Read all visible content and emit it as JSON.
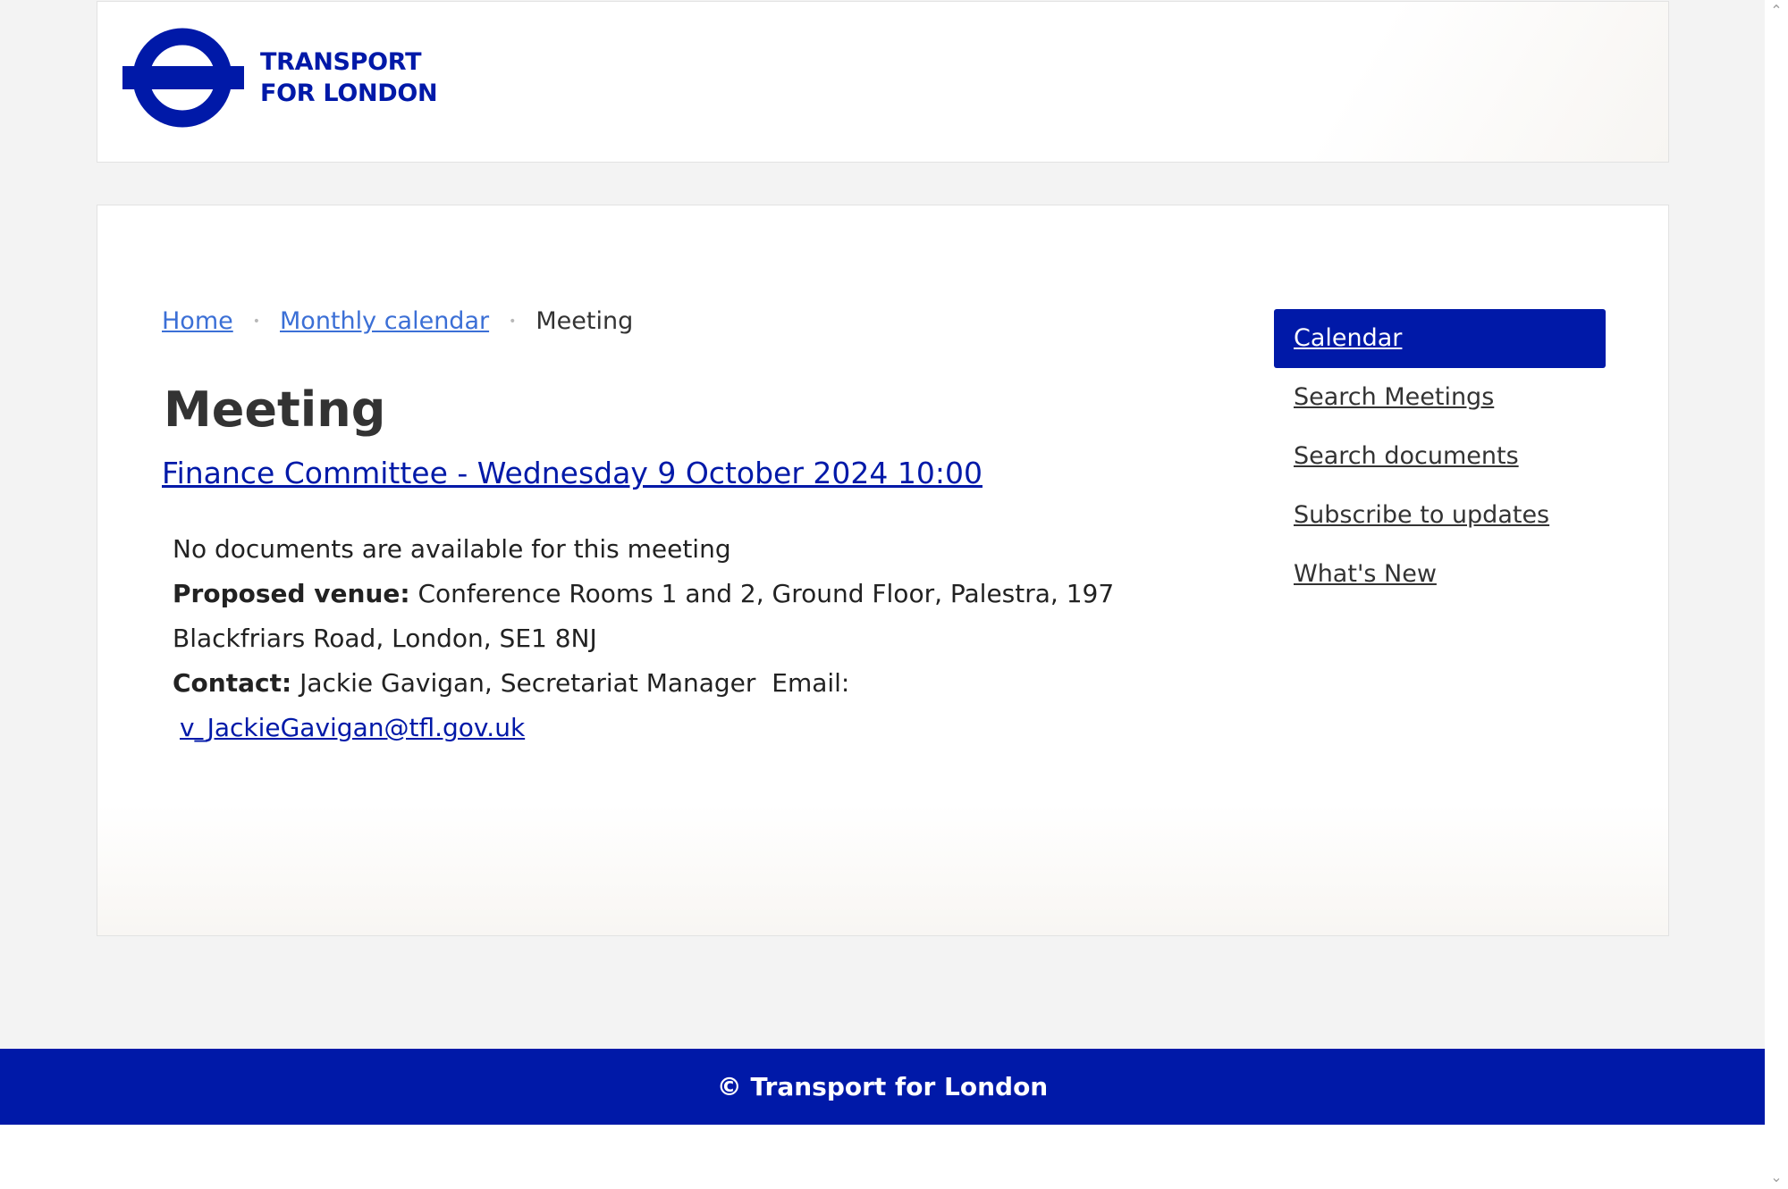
{
  "brand": {
    "logo_line1": "TRANSPORT",
    "logo_line2": "FOR LONDON",
    "color_primary": "#0019a8"
  },
  "breadcrumb": {
    "items": [
      {
        "label": "Home",
        "link": true
      },
      {
        "label": "Monthly calendar",
        "link": true
      },
      {
        "label": "Meeting",
        "link": false
      }
    ],
    "separator": "•"
  },
  "main": {
    "title": "Meeting",
    "meeting_link": "Finance Committee - Wednesday 9 October 2024 10:00",
    "no_documents": "No documents are available for this meeting",
    "venue_label": "Proposed venue:",
    "venue_value": "Conference Rooms 1 and 2, Ground Floor, Palestra, 197 Blackfriars Road, London, SE1 8NJ",
    "contact_label": "Contact:",
    "contact_value": "Jackie Gavigan, Secretariat Manager",
    "email_label": "Email:",
    "email_value": "v_JackieGavigan@tfl.gov.uk"
  },
  "sidenav": {
    "items": [
      {
        "label": "Calendar",
        "active": true
      },
      {
        "label": "Search Meetings",
        "active": false
      },
      {
        "label": "Search documents",
        "active": false
      },
      {
        "label": "Subscribe to updates",
        "active": false
      },
      {
        "label": "What's New",
        "active": false
      }
    ]
  },
  "footer": {
    "copyright": "© Transport for London"
  },
  "scrollbar": {
    "up_icon": "chevron-up-icon",
    "down_icon": "chevron-down-icon"
  }
}
